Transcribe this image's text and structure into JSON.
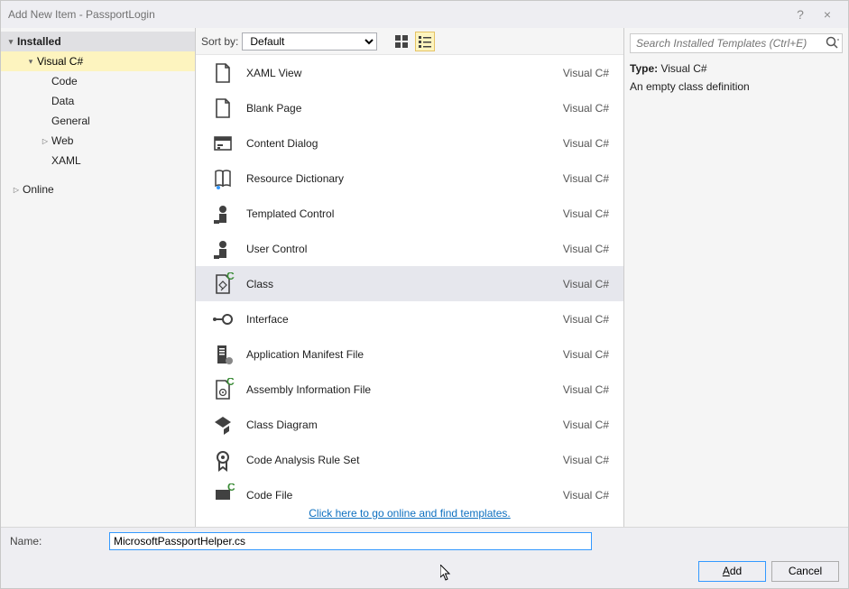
{
  "titlebar": {
    "title": "Add New Item - PassportLogin"
  },
  "sidebar": {
    "installed": "Installed",
    "visualcs": "Visual C#",
    "code": "Code",
    "data": "Data",
    "general": "General",
    "web": "Web",
    "xaml": "XAML",
    "online": "Online"
  },
  "sortby": {
    "label": "Sort by:",
    "value": "Default"
  },
  "templates": [
    {
      "name": "XAML View",
      "tech": "Visual C#",
      "icon": "page",
      "selected": false
    },
    {
      "name": "Blank Page",
      "tech": "Visual C#",
      "icon": "page",
      "selected": false
    },
    {
      "name": "Content Dialog",
      "tech": "Visual C#",
      "icon": "dialog",
      "selected": false
    },
    {
      "name": "Resource Dictionary",
      "tech": "Visual C#",
      "icon": "book",
      "selected": false
    },
    {
      "name": "Templated Control",
      "tech": "Visual C#",
      "icon": "control",
      "selected": false
    },
    {
      "name": "User Control",
      "tech": "Visual C#",
      "icon": "control",
      "selected": false
    },
    {
      "name": "Class",
      "tech": "Visual C#",
      "icon": "class",
      "selected": true
    },
    {
      "name": "Interface",
      "tech": "Visual C#",
      "icon": "interface",
      "selected": false
    },
    {
      "name": "Application Manifest File",
      "tech": "Visual C#",
      "icon": "manifest",
      "selected": false
    },
    {
      "name": "Assembly Information File",
      "tech": "Visual C#",
      "icon": "assembly",
      "selected": false
    },
    {
      "name": "Class Diagram",
      "tech": "Visual C#",
      "icon": "diagram",
      "selected": false
    },
    {
      "name": "Code Analysis Rule Set",
      "tech": "Visual C#",
      "icon": "badge",
      "selected": false
    },
    {
      "name": "Code File",
      "tech": "Visual C#",
      "icon": "codefile",
      "selected": false
    }
  ],
  "online_link": "Click here to go online and find templates.",
  "search": {
    "placeholder": "Search Installed Templates (Ctrl+E)"
  },
  "description": {
    "type_label": "Type:",
    "type_value": "Visual C#",
    "text": "An empty class definition"
  },
  "name_row": {
    "label": "Name:",
    "value": "MicrosoftPassportHelper.cs"
  },
  "buttons": {
    "add": "Add",
    "cancel": "Cancel"
  }
}
